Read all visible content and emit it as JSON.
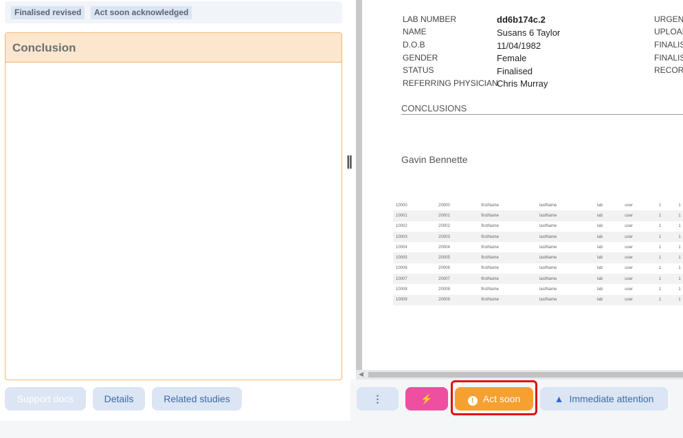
{
  "tags": [
    "Finalised revised",
    "Act soon acknowledged"
  ],
  "conclusion_panel": {
    "title": "Conclusion"
  },
  "left_buttons": {
    "support_docs": "Support docs",
    "details": "Details",
    "related_studies": "Related studies"
  },
  "report": {
    "fields": [
      {
        "label": "LAB NUMBER",
        "value": "dd6b174c.2"
      },
      {
        "label": "NAME",
        "value": "Susans 6 Taylor"
      },
      {
        "label": "D.O.B",
        "value": "11/04/1982"
      },
      {
        "label": "GENDER",
        "value": "Female"
      },
      {
        "label": "STATUS",
        "value": "Finalised"
      },
      {
        "label": "REFERRING PHYSICIAN",
        "value": "Chris Murray"
      }
    ],
    "right_labels": [
      "URGEN",
      "UPLOAI",
      "FINALIS",
      "FINALIS",
      "RECOR"
    ],
    "conclusions_heading": "CONCLUSIONS",
    "signer": "Gavin Bennette",
    "table_rows": [
      [
        "10000",
        "20000",
        "firstName",
        "lastName",
        "lab",
        "user",
        "1",
        "1"
      ],
      [
        "10001",
        "20001",
        "firstName",
        "lastName",
        "lab",
        "user",
        "1",
        "1"
      ],
      [
        "10002",
        "20002",
        "firstName",
        "lastName",
        "lab",
        "user",
        "1",
        "1"
      ],
      [
        "10003",
        "20003",
        "firstName",
        "lastName",
        "lab",
        "user",
        "1",
        "1"
      ],
      [
        "10004",
        "20004",
        "firstName",
        "lastName",
        "lab",
        "user",
        "1",
        "1"
      ],
      [
        "10005",
        "20005",
        "firstName",
        "lastName",
        "lab",
        "user",
        "1",
        "1"
      ],
      [
        "10006",
        "20006",
        "firstName",
        "lastName",
        "lab",
        "user",
        "1",
        "1"
      ],
      [
        "10007",
        "20007",
        "firstName",
        "lastName",
        "lab",
        "user",
        "1",
        "1"
      ],
      [
        "10008",
        "20008",
        "firstName",
        "lastName",
        "lab",
        "user",
        "1",
        "1"
      ],
      [
        "10009",
        "20009",
        "firstName",
        "lastName",
        "lab",
        "user",
        "1",
        "1"
      ]
    ]
  },
  "actions": {
    "more_icon": "vertical-ellipsis-icon",
    "lightning_icon": "lightning-icon",
    "act_soon": "Act soon",
    "act_soon_icon": "exclamation-circle-icon",
    "immediate_attention": "Immediate attention",
    "immediate_attention_icon": "warning-triangle-icon"
  },
  "colors": {
    "conclusion_border": "#f0b673",
    "conclusion_header_bg": "#fce6cd",
    "act_soon_bg": "#f5a030",
    "lightning_bg": "#ee4fa0",
    "highlight": "#e01010",
    "button_bg": "#dbe5f3"
  }
}
